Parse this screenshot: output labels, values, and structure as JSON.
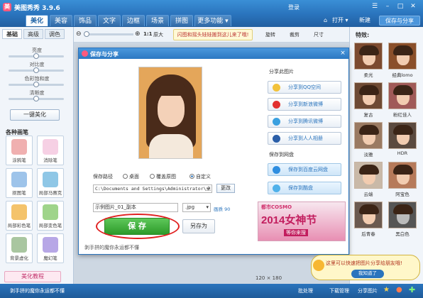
{
  "app": {
    "title": "美图秀秀 3.9.6",
    "logo_glyph": "美",
    "login": "登录"
  },
  "window_buttons": [
    "skin-icon",
    "minimize-icon",
    "maximize-icon",
    "close-icon"
  ],
  "main_tabs": [
    {
      "label": "美化",
      "active": true
    },
    {
      "label": "美容"
    },
    {
      "label": "饰品"
    },
    {
      "label": "文字"
    },
    {
      "label": "边框"
    },
    {
      "label": "场景"
    },
    {
      "label": "拼图"
    },
    {
      "label": "更多功能 ▾"
    }
  ],
  "top_actions": {
    "home": "⌂",
    "open": "打开 ▾",
    "new": "新建",
    "save_share": "保存与分享"
  },
  "left_panel": {
    "tabs": [
      "基础",
      "高级",
      "调色"
    ],
    "sliders": [
      {
        "label": "亮度",
        "value": 0.5
      },
      {
        "label": "对比度",
        "value": 0.5
      },
      {
        "label": "色彩饱和度",
        "value": 0.5
      },
      {
        "label": "清晰度",
        "value": 0.5
      }
    ],
    "one_click": "一键美化",
    "brush_heading": "各种画笔",
    "tools": [
      "涂鸦笔",
      "消除笔",
      "抠图笔",
      "局部马赛克",
      "局部彩色笔",
      "局部变色笔",
      "背景虚化",
      "魔幻笔"
    ],
    "tutorial": "美化教程"
  },
  "toolbar": {
    "zoom_value": "1:1",
    "original_size": "原大",
    "tip": "闪图和摇头娃娃搬到这儿来了哦!",
    "rotate": "旋转",
    "crop": "裁剪",
    "resize": "尺寸"
  },
  "right_panel": {
    "label": "特效:",
    "effects": [
      "柔光",
      "经典lomo",
      "复古",
      "粉红佳人",
      "淡雅",
      "HDR",
      "云端",
      "阿宝色",
      "后青春",
      "黑白色"
    ]
  },
  "dialog": {
    "title": "保存与分享",
    "close": "×",
    "path_label": "保存路径",
    "path_options": [
      {
        "label": "桌面",
        "selected": false
      },
      {
        "label": "覆盖原图",
        "selected": false
      },
      {
        "label": "自定义",
        "selected": true
      }
    ],
    "path_value": "C:\\Documents and Settings\\Administrator\\桌",
    "change": "更改",
    "filename": "示例图片_01_副本",
    "format": ".jpg",
    "quality": "画质 90",
    "save": "保 存",
    "save_as": "另存为",
    "hint": "剥手拼的魔你永运都不懂",
    "share_title": "分享此图片",
    "share_buttons": [
      "分享到QQ空间",
      "分享到新浪微博",
      "分享到腾讯微博",
      "分享到人人相册"
    ],
    "disk_title": "保存到网盘",
    "disk_buttons": [
      "保存到百度云网盘",
      "保存到酷盘"
    ],
    "ad_brand": "都市COSMO",
    "ad_headline": "2014女神节",
    "ad_sub": "等你来搜"
  },
  "size_readout": "120 × 180",
  "bubble": {
    "text": "这里可以快速把图片分享给朋友哦!",
    "button": "我知道了"
  },
  "status": {
    "hint": "剥手拼的魔你永运都不懂",
    "batch": "批处理",
    "download": "下载管理",
    "share_image": "分享图片"
  }
}
